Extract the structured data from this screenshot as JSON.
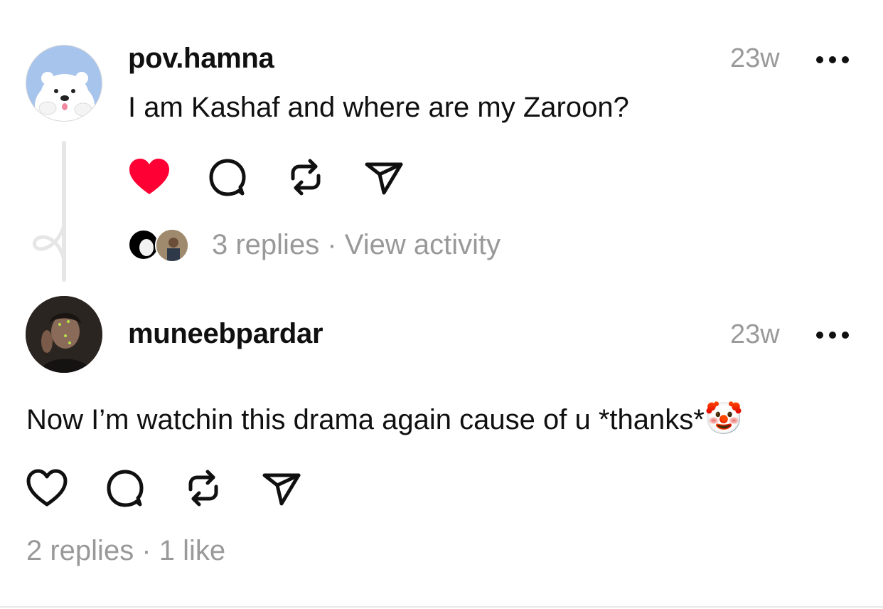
{
  "post": {
    "username": "pov.hamna",
    "time": "23w",
    "text": "I am Kashaf and where are my Zaroon?",
    "liked": true,
    "meta": "3 replies · View activity",
    "avatar_icon": "polar-bear-avatar"
  },
  "reply": {
    "username": "muneebpardar",
    "time": "23w",
    "text": "Now I’m watchin this drama again cause of u *thanks*",
    "emoji": "🤡",
    "liked": false,
    "meta": "2 replies · 1 like",
    "avatar_icon": "profile-photo"
  },
  "icons": {
    "like": "heart-icon",
    "comment": "comment-icon",
    "repost": "repost-icon",
    "share": "send-icon",
    "more": "more-icon"
  },
  "colors": {
    "liked_heart": "#ff0034",
    "secondary_text": "#999999",
    "primary_text": "#101010"
  }
}
